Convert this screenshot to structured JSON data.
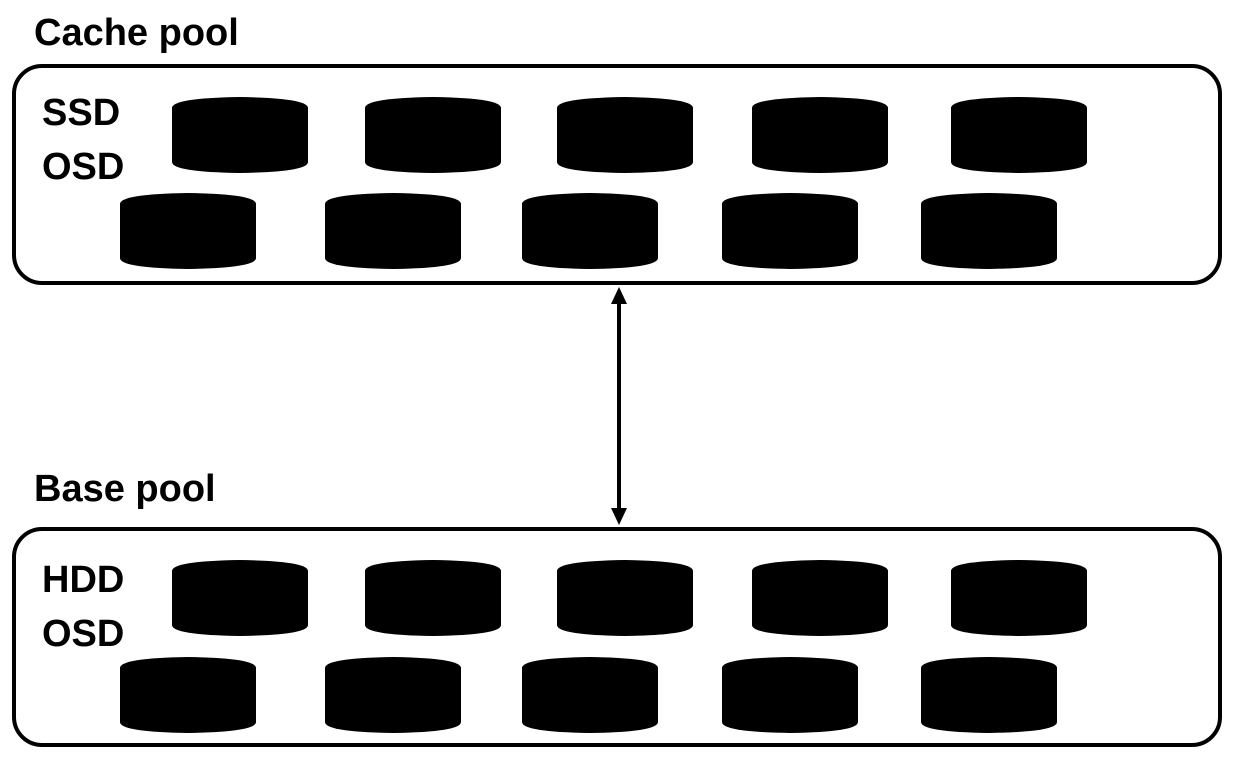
{
  "diagram": {
    "pools": [
      {
        "title": "Cache pool",
        "device_type": [
          "SSD",
          "OSD"
        ],
        "disk_count": 10,
        "disk_icon": "cylinder-disk-icon",
        "disk_color": "#000000"
      },
      {
        "title": "Base pool",
        "device_type": [
          "HDD",
          "OSD"
        ],
        "disk_count": 10,
        "disk_icon": "cylinder-disk-icon",
        "disk_color": "#000000"
      }
    ],
    "connector": {
      "type": "bidirectional-arrow",
      "from": "Cache pool",
      "to": "Base pool"
    }
  }
}
